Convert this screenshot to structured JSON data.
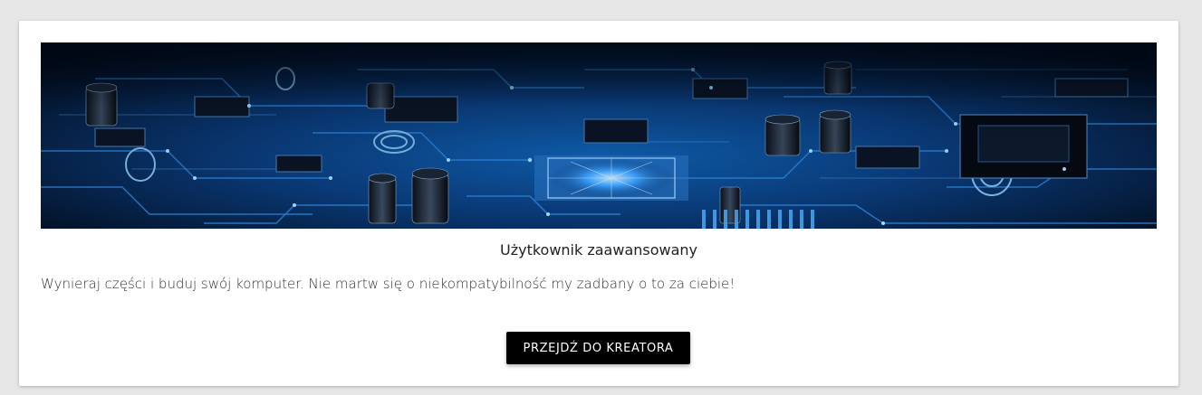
{
  "card": {
    "title": "Użytkownik zaawansowany",
    "description": "Wynieraj części i buduj swój komputer. Nie martw się o niekompatybilność my zadbany o to za ciebie!",
    "button_label": "PRZEJDŹ DO KREATORA"
  },
  "colors": {
    "page_background": "#e6e6e6",
    "card_background": "#ffffff",
    "button_background": "#000000",
    "button_text": "#ffffff",
    "circuit_glow": "#1e90ff"
  }
}
